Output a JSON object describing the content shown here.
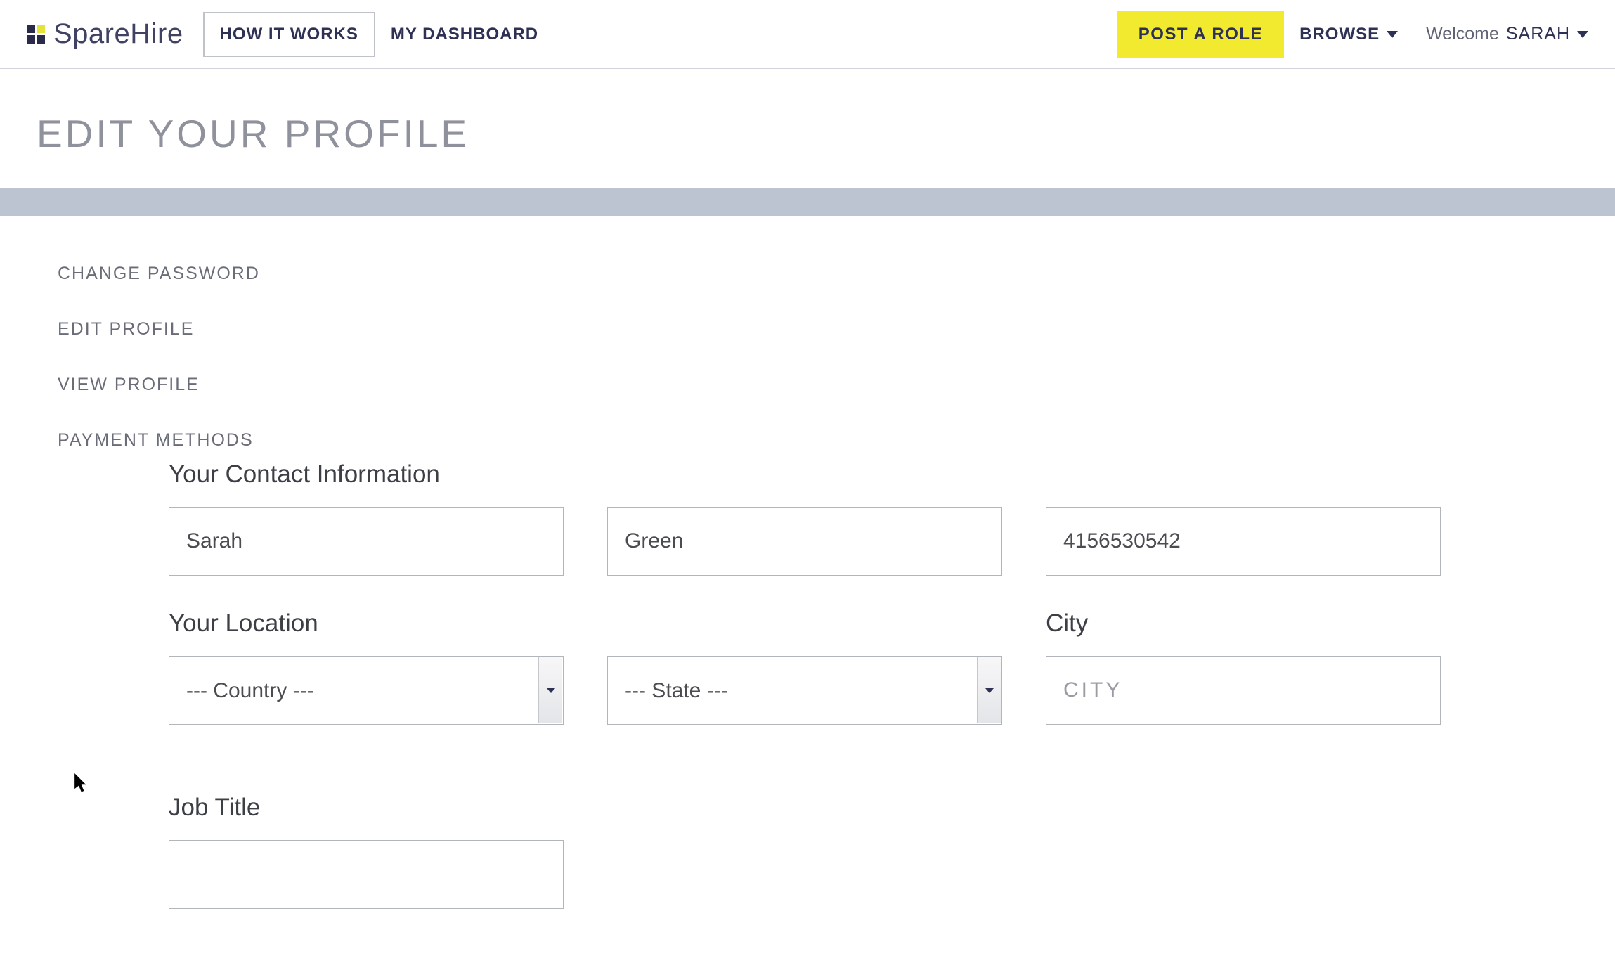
{
  "header": {
    "brand": "SpareHire",
    "how_it_works": "HOW IT WORKS",
    "dashboard": "MY DASHBOARD",
    "post_role": "POST A ROLE",
    "browse": "BROWSE",
    "welcome_prefix": "Welcome",
    "welcome_name": "SARAH"
  },
  "page": {
    "title": "EDIT YOUR PROFILE"
  },
  "sidenav": {
    "change_password": "CHANGE PASSWORD",
    "edit_profile": "EDIT PROFILE",
    "view_profile": "VIEW PROFILE",
    "payment_methods": "PAYMENT METHODS"
  },
  "form": {
    "contact_section": "Your Contact Information",
    "first_name": "Sarah",
    "last_name": "Green",
    "phone": "4156530542",
    "location_section": "Your Location",
    "city_section": "City",
    "country_selected": "--- Country ---",
    "state_selected": "--- State ---",
    "city_placeholder": "CITY",
    "city_value": "",
    "job_title_section": "Job Title",
    "job_title_value": ""
  }
}
